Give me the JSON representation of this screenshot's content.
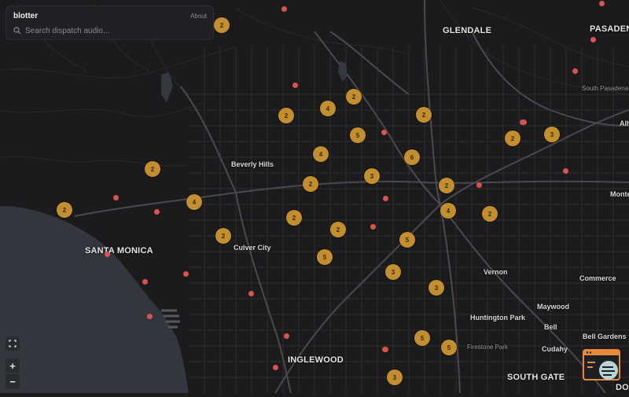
{
  "app": {
    "title": "blotter",
    "about_label": "About"
  },
  "search": {
    "placeholder": "Search dispatch audio..."
  },
  "controls": {
    "fullscreen_icon": "fullscreen-icon",
    "zoom_in_label": "+",
    "zoom_out_label": "−"
  },
  "places": [
    {
      "name": "GLENDALE"
    },
    {
      "name": "PASADENA"
    },
    {
      "name": "South Pasadena"
    },
    {
      "name": "Beverly Hills"
    },
    {
      "name": "SANTA MONICA"
    },
    {
      "name": "Culver City"
    },
    {
      "name": "Vernon"
    },
    {
      "name": "Commerce"
    },
    {
      "name": "Maywood"
    },
    {
      "name": "Huntington Park"
    },
    {
      "name": "Bell"
    },
    {
      "name": "Bell Gardens"
    },
    {
      "name": "Cudahy"
    },
    {
      "name": "INGLEWOOD"
    },
    {
      "name": "SOUTH GATE"
    },
    {
      "name": "Firestone Park"
    },
    {
      "name": "Monte"
    },
    {
      "name": "Alh"
    },
    {
      "name": "DOW"
    }
  ],
  "clusters": [
    {
      "count": "2"
    },
    {
      "count": "2"
    },
    {
      "count": "4"
    },
    {
      "count": "2"
    },
    {
      "count": "5"
    },
    {
      "count": "2"
    },
    {
      "count": "4"
    },
    {
      "count": "6"
    },
    {
      "count": "2"
    },
    {
      "count": "3"
    },
    {
      "count": "2"
    },
    {
      "count": "2"
    },
    {
      "count": "3"
    },
    {
      "count": "2"
    },
    {
      "count": "4"
    },
    {
      "count": "2"
    },
    {
      "count": "4"
    },
    {
      "count": "2"
    },
    {
      "count": "2"
    },
    {
      "count": "2"
    },
    {
      "count": "5"
    },
    {
      "count": "5"
    },
    {
      "count": "3"
    },
    {
      "count": "3"
    },
    {
      "count": "5"
    },
    {
      "count": "5"
    },
    {
      "count": "3"
    }
  ],
  "incident_count": 23,
  "colors": {
    "land": "#1b1b1d",
    "water": "#33363d",
    "roads": "#3a3a3d",
    "cluster": "#c28e2f",
    "incident": "#d9534f",
    "brand": "#e58a3a"
  },
  "brand_icon": "dispatch-radio-logo-icon"
}
